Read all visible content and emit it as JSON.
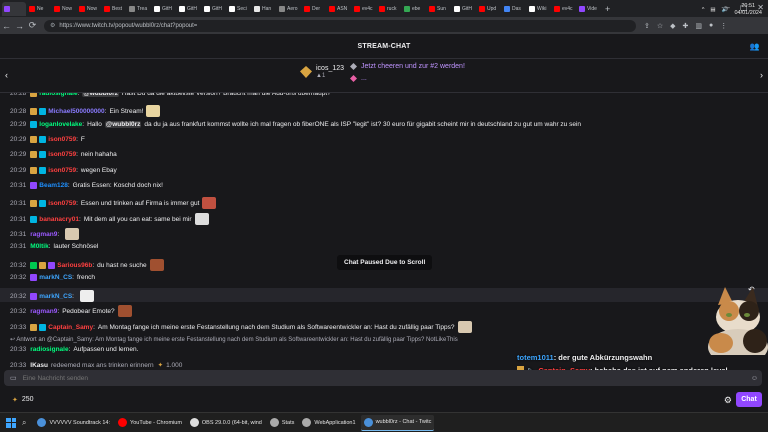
{
  "browser": {
    "tabs": [
      {
        "label": "",
        "color": "#9147ff"
      },
      {
        "label": "Ne",
        "color": "#ff0000"
      },
      {
        "label": "Now",
        "color": "#ff0000"
      },
      {
        "label": "Now",
        "color": "#ff0000"
      },
      {
        "label": "Best",
        "color": "#ff0000"
      },
      {
        "label": "Trea",
        "color": "#888888"
      },
      {
        "label": "GitH",
        "color": "#ffffff"
      },
      {
        "label": "GitH",
        "color": "#ffffff"
      },
      {
        "label": "GitH",
        "color": "#ffffff"
      },
      {
        "label": "Seci",
        "color": "#ffffff"
      },
      {
        "label": "Han",
        "color": "#e8e8e8"
      },
      {
        "label": "Aero",
        "color": "#888888"
      },
      {
        "label": "Der",
        "color": "#ff0000"
      },
      {
        "label": "ASN",
        "color": "#ff0000"
      },
      {
        "label": "ev4c",
        "color": "#ff0000"
      },
      {
        "label": "ruck",
        "color": "#ff0000"
      },
      {
        "label": "ebe",
        "color": "#34a853"
      },
      {
        "label": "Sun",
        "color": "#ff0000"
      },
      {
        "label": "GitH",
        "color": "#ffffff"
      },
      {
        "label": "Upd",
        "color": "#ff0000"
      },
      {
        "label": "Das",
        "color": "#4285f4"
      },
      {
        "label": "Wiki",
        "color": "#ffffff"
      },
      {
        "label": "ev4c",
        "color": "#ff0000"
      },
      {
        "label": "Vide",
        "color": "#9147ff"
      }
    ],
    "url": "https://www.twitch.tv/popout/wubbl0rz/chat?popout="
  },
  "chat": {
    "header_title": "STREAM-CHAT",
    "top_cheerer": {
      "name": "icos_123",
      "amount": "1"
    },
    "cheer_prompt": "Jetzt cheeren und zur #2 werden!",
    "cheer_more": "...",
    "messages": [
      {
        "time": "20:28",
        "badges": [
          "#d9a441"
        ],
        "name": "radiosignale",
        "name_color": "#00ff7f",
        "text": "Hast Du da die aktuellste Version? Braucht man die Add-ons überhaupt?",
        "mention": "@wubbl0rz",
        "emote": ""
      },
      {
        "time": "20:28",
        "badges": [
          "#d9a441",
          "#00b5e2"
        ],
        "name": "Michael500000000",
        "name_color": "#8a7bff",
        "text": "Ein Stream!",
        "emote": "#e8d5a0"
      },
      {
        "time": "20:29",
        "badges": [
          "#00b5e2"
        ],
        "name": "loganlovelake",
        "name_color": "#00ff7f",
        "text": "Hallo",
        "mention": "@wubbl0rz",
        "text2": "da du ja aus frankfurt kommst wollte ich mal fragen ob fiberONE als ISP \"legit\" ist? 30 euro für gigabit scheint mir in deutschland zu gut um wahr zu sein",
        "emote": ""
      },
      {
        "time": "20:29",
        "badges": [
          "#d9a441",
          "#00b5e2"
        ],
        "name": "ison0759",
        "name_color": "#ff4040",
        "text": "F",
        "emote": ""
      },
      {
        "time": "20:29",
        "badges": [
          "#d9a441",
          "#00b5e2"
        ],
        "name": "ison0759",
        "name_color": "#ff4040",
        "text": "nein hahaha",
        "emote": ""
      },
      {
        "time": "20:29",
        "badges": [
          "#d9a441",
          "#00b5e2"
        ],
        "name": "ison0759",
        "name_color": "#ff4040",
        "text": "wegen Ebay",
        "emote": ""
      },
      {
        "time": "20:31",
        "badges": [
          "#9147ff"
        ],
        "name": "Beam128",
        "name_color": "#1e90ff",
        "text": "Gratis Essen: Koschd doch nix!",
        "emote": ""
      },
      {
        "time": "20:31",
        "badges": [
          "#d9a441",
          "#00b5e2"
        ],
        "name": "ison0759",
        "name_color": "#ff4040",
        "text": "Essen und trinken auf Firma is immer gut",
        "emote": "#c05040"
      },
      {
        "time": "20:31",
        "badges": [
          "#00b5e2"
        ],
        "name": "bananacry01",
        "name_color": "#ff4040",
        "text": "Mit dem all you can eat: same bei mir",
        "emote": "#dddddd"
      },
      {
        "time": "20:31",
        "badges": [],
        "name": "ragman9",
        "name_color": "#9b59ff",
        "text": "",
        "emote": "#d8c8b0"
      },
      {
        "time": "20:31",
        "badges": [],
        "name": "M0ltik",
        "name_color": "#00ff7f",
        "text": "lauter Schnösel",
        "emote": ""
      },
      {
        "time": "20:32",
        "badges": [
          "#00c850",
          "#d9a441",
          "#9147ff"
        ],
        "name": "Sarious96b",
        "name_color": "#ff4040",
        "text": "du hast ne suche",
        "emote": "#a05030"
      },
      {
        "time": "20:32",
        "badges": [
          "#9147ff"
        ],
        "name": "markN_CS",
        "name_color": "#3ea6ff",
        "text": "french",
        "emote": ""
      },
      {
        "time": "20:32",
        "badges": [
          "#9147ff"
        ],
        "name": "markN_CS",
        "name_color": "#3ea6ff",
        "text": "",
        "emote": "#eeeeee"
      },
      {
        "time": "20:32",
        "badges": [],
        "name": "ragman9",
        "name_color": "#9b59ff",
        "text": "Pedobear Emote?",
        "emote": "#a05030"
      },
      {
        "time": "20:33",
        "badges": [
          "#d9a441",
          "#00b5e2"
        ],
        "name": "Captain_Samy",
        "name_color": "#ff4040",
        "text": "Am Montag fange ich meine erste Festanstellung nach dem Studium als Softwareentwickler an: Hast du zufällig paar Tipps?",
        "emote": "#d8c8b0"
      }
    ],
    "reply_note": "Antwort an @Captain_Samy: Am Montag fange ich meine erste Festanstellung nach dem Studium als Softwareentwickler an: Hast du zufällig paar Tipps? NotLikeThis",
    "reply_msg": {
      "time": "20:33",
      "name": "radiosignale",
      "text": "Aufpassen und lernen."
    },
    "redeem": {
      "time": "20:33",
      "name": "IKasu",
      "text": "redeemed max ans trinken erinnern",
      "cost": "1.000"
    },
    "paused_label": "Chat Paused Due to Scroll",
    "input_placeholder": "Eine Nachricht senden",
    "points": "250",
    "chat_button": "Chat"
  },
  "overlay": [
    {
      "name": "totem1011",
      "name_color": "#3ea6ff",
      "text": "der gute Abkürzungswahn"
    },
    {
      "name": "Captain_Samy",
      "name_color": "#ff4040",
      "text": "hahaha das ist auf nem anderen level"
    }
  ],
  "taskbar": {
    "items": [
      {
        "label": "VVVVVV Soundtrack 14:",
        "color": "#4a90d9",
        "active": false
      },
      {
        "label": "YouTube - Chromium",
        "color": "#ff0000",
        "active": false
      },
      {
        "label": "OBS 29.0.0 (64-bit, wind",
        "color": "#dddddd",
        "active": false
      },
      {
        "label": "Stats",
        "color": "#aaaaaa",
        "active": false
      },
      {
        "label": "WebApplication1",
        "color": "#aaaaaa",
        "active": false
      },
      {
        "label": "wubbl0rz - Chat - Twitc",
        "color": "#4a90d9",
        "active": true
      }
    ],
    "time": "20:51",
    "date": "04/01/2024"
  }
}
